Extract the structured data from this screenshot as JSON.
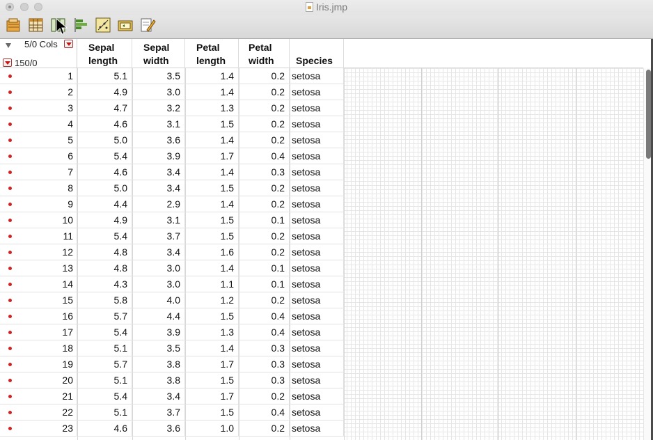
{
  "window": {
    "title": "Iris.jmp"
  },
  "toolbar": {
    "buttons": [
      "open-data-icon",
      "table-icon",
      "columns-icon",
      "distribution-icon",
      "graph-icon",
      "script-icon",
      "edit-icon"
    ]
  },
  "table": {
    "cols_count": "5/0 Cols",
    "rows_count": "150/0",
    "columns": [
      {
        "line1": "Sepal",
        "line2": "length"
      },
      {
        "line1": "Sepal",
        "line2": "width"
      },
      {
        "line1": "Petal",
        "line2": "length"
      },
      {
        "line1": "Petal",
        "line2": "width"
      },
      {
        "line1": "",
        "line2": "Species"
      }
    ],
    "rows": [
      [
        "1",
        "5.1",
        "3.5",
        "1.4",
        "0.2",
        "setosa"
      ],
      [
        "2",
        "4.9",
        "3.0",
        "1.4",
        "0.2",
        "setosa"
      ],
      [
        "3",
        "4.7",
        "3.2",
        "1.3",
        "0.2",
        "setosa"
      ],
      [
        "4",
        "4.6",
        "3.1",
        "1.5",
        "0.2",
        "setosa"
      ],
      [
        "5",
        "5.0",
        "3.6",
        "1.4",
        "0.2",
        "setosa"
      ],
      [
        "6",
        "5.4",
        "3.9",
        "1.7",
        "0.4",
        "setosa"
      ],
      [
        "7",
        "4.6",
        "3.4",
        "1.4",
        "0.3",
        "setosa"
      ],
      [
        "8",
        "5.0",
        "3.4",
        "1.5",
        "0.2",
        "setosa"
      ],
      [
        "9",
        "4.4",
        "2.9",
        "1.4",
        "0.2",
        "setosa"
      ],
      [
        "10",
        "4.9",
        "3.1",
        "1.5",
        "0.1",
        "setosa"
      ],
      [
        "11",
        "5.4",
        "3.7",
        "1.5",
        "0.2",
        "setosa"
      ],
      [
        "12",
        "4.8",
        "3.4",
        "1.6",
        "0.2",
        "setosa"
      ],
      [
        "13",
        "4.8",
        "3.0",
        "1.4",
        "0.1",
        "setosa"
      ],
      [
        "14",
        "4.3",
        "3.0",
        "1.1",
        "0.1",
        "setosa"
      ],
      [
        "15",
        "5.8",
        "4.0",
        "1.2",
        "0.2",
        "setosa"
      ],
      [
        "16",
        "5.7",
        "4.4",
        "1.5",
        "0.4",
        "setosa"
      ],
      [
        "17",
        "5.4",
        "3.9",
        "1.3",
        "0.4",
        "setosa"
      ],
      [
        "18",
        "5.1",
        "3.5",
        "1.4",
        "0.3",
        "setosa"
      ],
      [
        "19",
        "5.7",
        "3.8",
        "1.7",
        "0.3",
        "setosa"
      ],
      [
        "20",
        "5.1",
        "3.8",
        "1.5",
        "0.3",
        "setosa"
      ],
      [
        "21",
        "5.4",
        "3.4",
        "1.7",
        "0.2",
        "setosa"
      ],
      [
        "22",
        "5.1",
        "3.7",
        "1.5",
        "0.4",
        "setosa"
      ],
      [
        "23",
        "4.6",
        "3.6",
        "1.0",
        "0.2",
        "setosa"
      ]
    ]
  },
  "colors": {
    "row_marker": "#d42222",
    "menu_triangle": "#cc1111"
  }
}
